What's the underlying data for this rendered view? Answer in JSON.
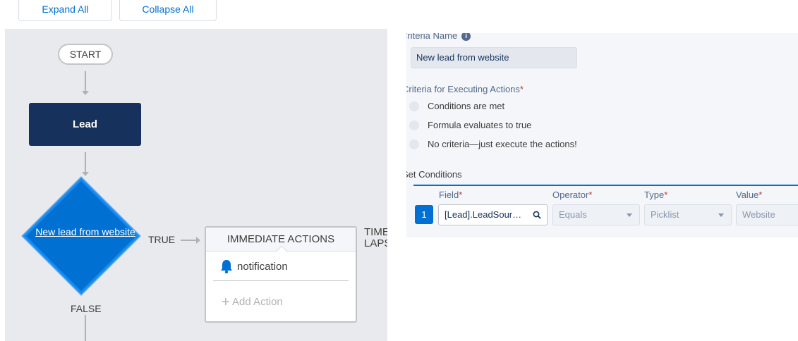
{
  "top_buttons": {
    "expand": "Expand All",
    "collapse": "Collapse All"
  },
  "flow": {
    "start": "START",
    "object": "Lead",
    "criteria_node": "New lead from website",
    "true_label": "TRUE",
    "false_label": "FALSE",
    "immediate_actions": {
      "header": "IMMEDIATE ACTIONS",
      "action_name": "notification",
      "action_icon": "bell-icon",
      "add_label": "Add Action"
    },
    "time_label": "TIME LAPSE"
  },
  "criteria_panel": {
    "name_label": "Criteria Name",
    "name_value": "New lead from website",
    "executing_label": "Criteria for Executing Actions",
    "options": [
      "Conditions are met",
      "Formula evaluates to true",
      "No criteria—just execute the actions!"
    ],
    "set_conditions_label": "Set Conditions",
    "columns": {
      "field": "Field",
      "operator": "Operator",
      "type": "Type",
      "value": "Value"
    },
    "row": {
      "number": "1",
      "field": "[Lead].LeadSour…",
      "operator": "Equals",
      "type": "Picklist",
      "value": "Website"
    }
  },
  "colors": {
    "accent": "#0070d2",
    "node_dark": "#16325c",
    "canvas": "#e9eaed"
  }
}
